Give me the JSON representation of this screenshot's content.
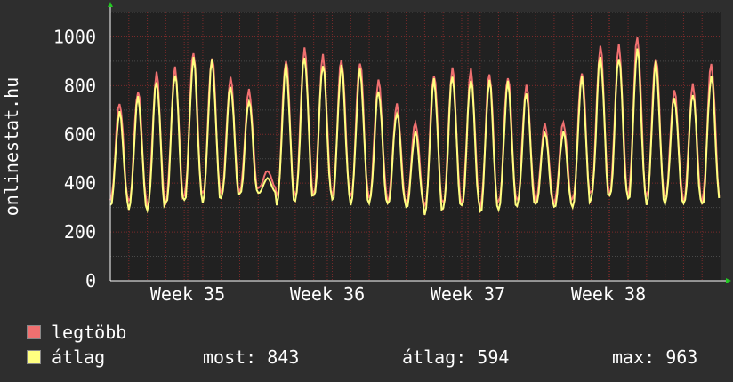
{
  "chart_data": {
    "type": "line",
    "ylabel": "onlinestat.hu",
    "ylim": [
      0,
      1100
    ],
    "yticks": [
      0,
      200,
      400,
      600,
      800,
      1000
    ],
    "xticks": [
      "Week 35",
      "Week 36",
      "Week 37",
      "Week 38"
    ],
    "grid": true,
    "colors": {
      "background": "#2e2e2e",
      "plot_background": "#212121",
      "grid": "#4a4a4a",
      "grid_minor": "#7a2a2a",
      "axis": "#ffffff",
      "arrow": "#22c822",
      "legtobb": "#f07070",
      "atlag": "#ffff80"
    },
    "series": [
      {
        "name": "legtöbb",
        "color": "#f07070",
        "daily_peaks": [
          730,
          780,
          850,
          870,
          940,
          920,
          830,
          780,
          450,
          910,
          950,
          920,
          910,
          900,
          820,
          720,
          650,
          850,
          870,
          860,
          850,
          840,
          800,
          640,
          650,
          860,
          960,
          960,
          1000,
          920,
          780,
          800,
          890
        ],
        "daily_troughs": [
          330,
          320,
          310,
          330,
          350,
          350,
          360,
          370,
          380,
          340,
          350,
          360,
          350,
          340,
          340,
          330,
          320,
          300,
          320,
          320,
          300,
          320,
          330,
          330,
          320,
          330,
          360,
          360,
          350,
          340,
          340,
          330,
          330
        ]
      },
      {
        "name": "átlag",
        "color": "#ffff80",
        "daily_peaks": [
          690,
          750,
          820,
          850,
          910,
          900,
          800,
          740,
          420,
          880,
          920,
          890,
          880,
          860,
          780,
          690,
          610,
          820,
          840,
          830,
          820,
          810,
          770,
          610,
          610,
          830,
          920,
          920,
          950,
          890,
          750,
          770,
          840
        ],
        "daily_troughs": [
          310,
          300,
          290,
          310,
          330,
          330,
          340,
          350,
          360,
          320,
          330,
          340,
          330,
          320,
          320,
          310,
          300,
          280,
          300,
          300,
          280,
          300,
          310,
          310,
          300,
          310,
          340,
          340,
          330,
          320,
          320,
          310,
          310
        ]
      }
    ]
  },
  "legend": {
    "item1": "legtöbb",
    "item2": "átlag"
  },
  "stats": {
    "most": "most: 843",
    "atlag": "átlag: 594",
    "max": "max: 963"
  }
}
